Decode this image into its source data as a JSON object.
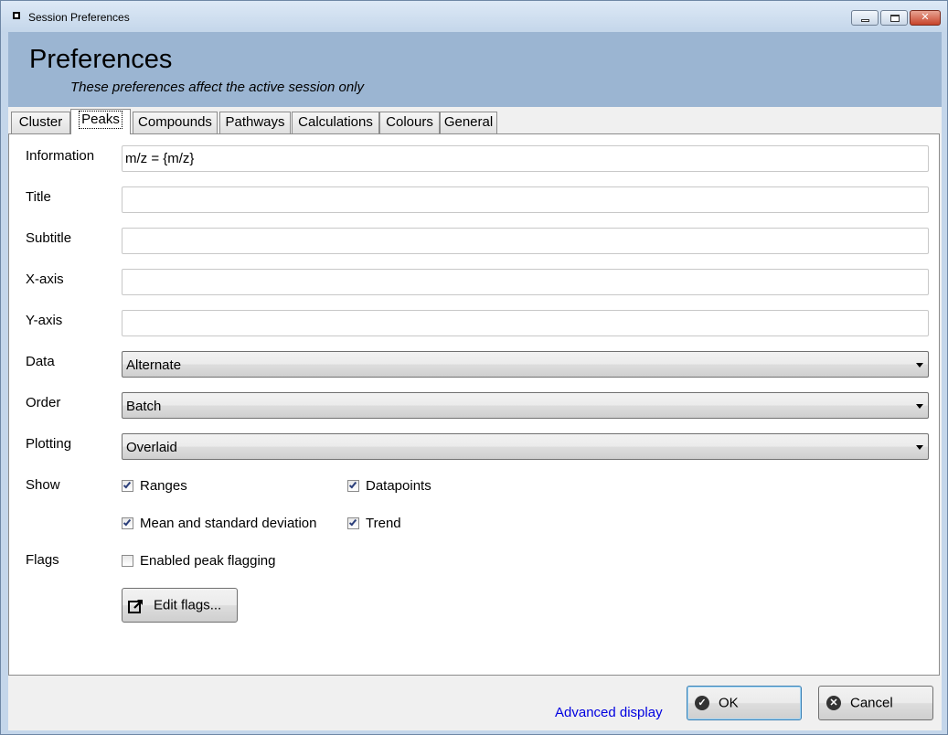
{
  "window": {
    "title": "Session Preferences"
  },
  "header": {
    "title": "Preferences",
    "subtitle": "These preferences affect the active session only"
  },
  "tabs": [
    {
      "label": "Cluster"
    },
    {
      "label": "Peaks",
      "active": true
    },
    {
      "label": "Compounds"
    },
    {
      "label": "Pathways"
    },
    {
      "label": "Calculations"
    },
    {
      "label": "Colours"
    },
    {
      "label": "General"
    }
  ],
  "peaks": {
    "information": {
      "label": "Information",
      "value": "m/z = {m/z}"
    },
    "title": {
      "label": "Title",
      "value": ""
    },
    "subtitle": {
      "label": "Subtitle",
      "value": ""
    },
    "xaxis": {
      "label": "X-axis",
      "value": ""
    },
    "yaxis": {
      "label": "Y-axis",
      "value": ""
    },
    "data": {
      "label": "Data",
      "value": "Alternate"
    },
    "order": {
      "label": "Order",
      "value": "Batch"
    },
    "plotting": {
      "label": "Plotting",
      "value": "Overlaid"
    },
    "show": {
      "label": "Show",
      "ranges": {
        "label": "Ranges",
        "checked": true
      },
      "datapoints": {
        "label": "Datapoints",
        "checked": true
      },
      "mean_sd": {
        "label": "Mean and standard deviation",
        "checked": true
      },
      "trend": {
        "label": "Trend",
        "checked": true
      }
    },
    "flags": {
      "label": "Flags",
      "enable": {
        "label": "Enabled peak flagging",
        "checked": false
      },
      "edit_button": "Edit flags..."
    }
  },
  "footer": {
    "advanced_link": "Advanced display",
    "ok_label": "OK",
    "cancel_label": "Cancel"
  },
  "colors": {
    "header_bg": "#9bb5d2",
    "link": "#0000e0",
    "checkmark": "#2b3f7a"
  }
}
